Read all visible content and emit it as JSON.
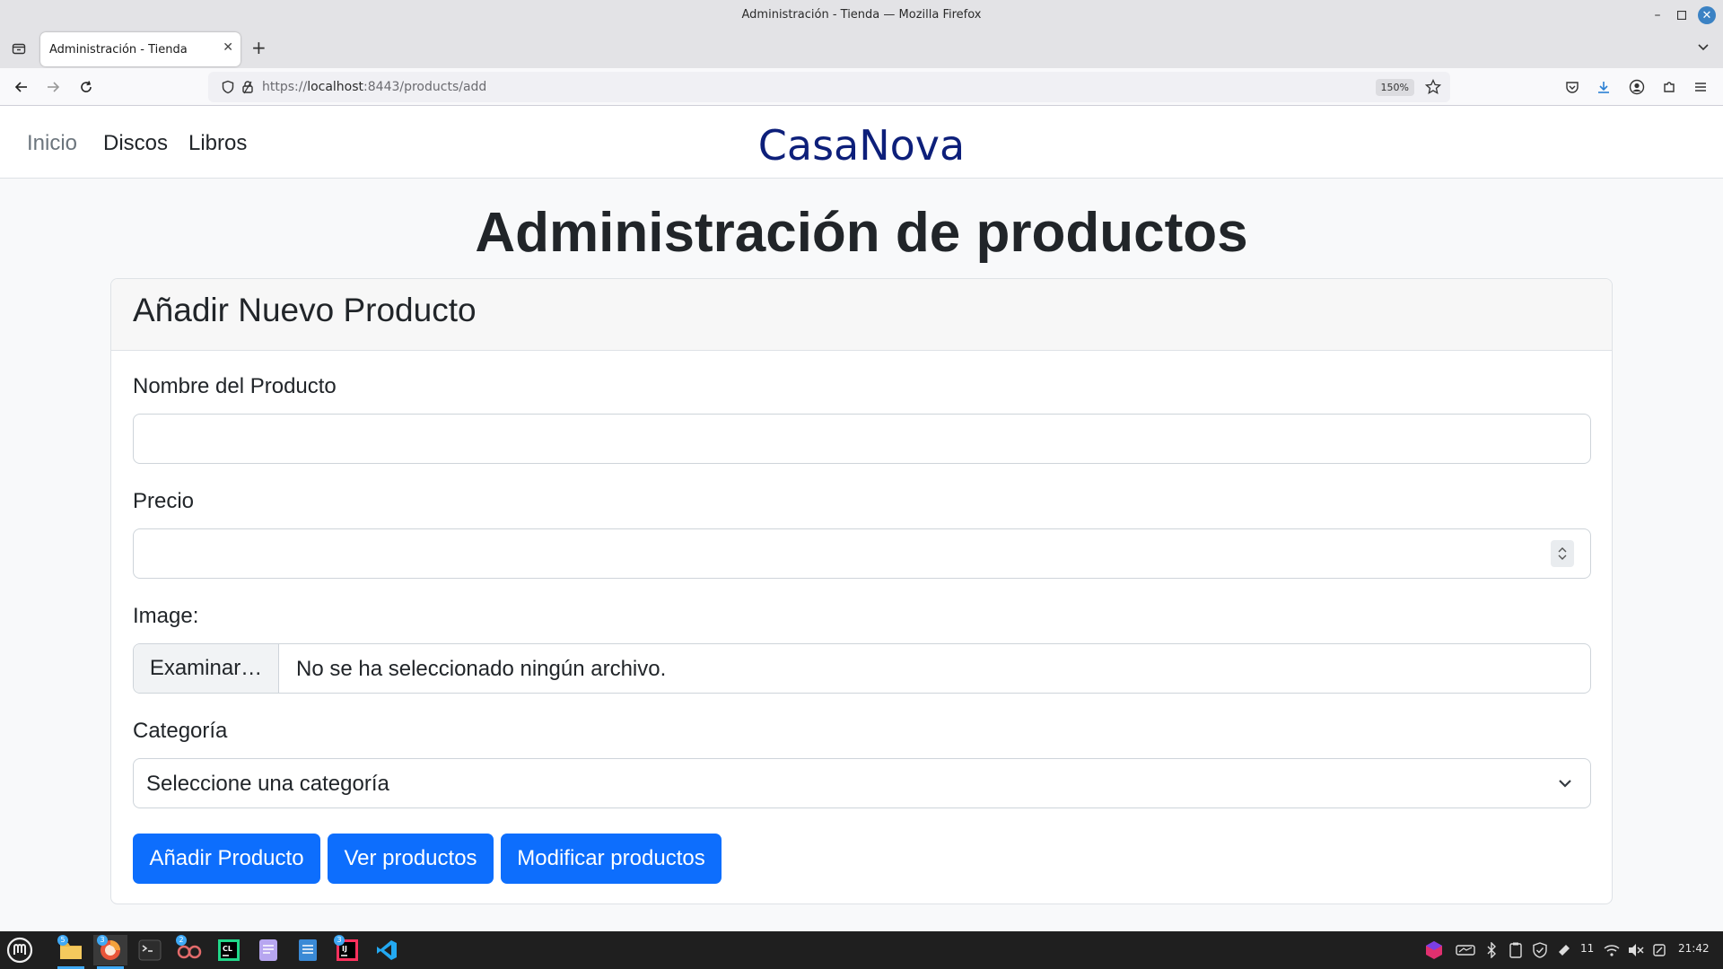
{
  "window": {
    "title": "Administración - Tienda — Mozilla Firefox",
    "tab_title": "Administración - Tienda",
    "close_tab_glyph": "✕",
    "new_tab_glyph": "+"
  },
  "browser": {
    "url_scheme": "https://",
    "url_host": "localhost",
    "url_rest": ":8443/products/add",
    "zoom": "150%"
  },
  "site": {
    "nav": [
      "Inicio",
      "Discos",
      "Libros"
    ],
    "brand": "CasaNova",
    "page_title": "Administración de productos"
  },
  "form": {
    "card_title": "Añadir Nuevo Producto",
    "name_label": "Nombre del Producto",
    "name_value": "",
    "price_label": "Precio",
    "price_value": "",
    "image_label": "Image:",
    "file_button": "Examinar…",
    "file_status": "No se ha seleccionado ningún archivo.",
    "category_label": "Categoría",
    "category_selected": "Seleccione una categoría",
    "buttons": [
      "Añadir Producto",
      "Ver productos",
      "Modificar productos"
    ]
  },
  "taskbar": {
    "badges": {
      "files": "5",
      "firefox": "3",
      "app4": "2",
      "intellij": "3"
    },
    "tray_count": "11",
    "clock": "21:42"
  },
  "colors": {
    "primary": "#0d6efd",
    "brand": "#0d1f7a",
    "page_bg": "#f8f9fa",
    "taskbar_bg": "#1f1f1f"
  }
}
